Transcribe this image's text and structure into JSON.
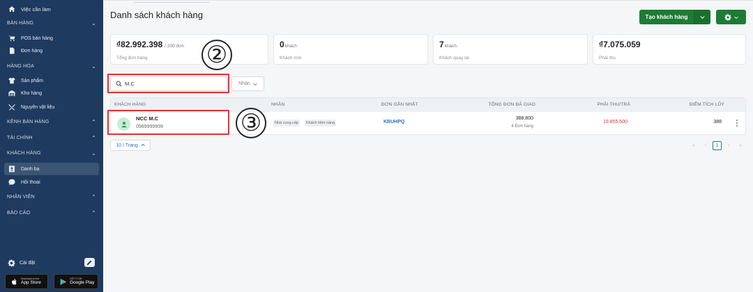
{
  "sidebar": {
    "todo_label": "Việc cần làm",
    "sections": {
      "ban_hang": "BÁN HÀNG",
      "hang_hoa": "HÀNG HÓA",
      "kenh_ban_hang": "KÊNH BÁN HÀNG",
      "tai_chinh": "TÀI CHÍNH",
      "khach_hang": "KHÁCH HÀNG",
      "nhan_vien": "NHÂN VIÊN",
      "bao_cao": "BÁO CÁO"
    },
    "items": {
      "pos": "POS bán hàng",
      "don_hang": "Đơn hàng",
      "san_pham": "Sản phẩm",
      "kho_hang": "Kho hàng",
      "nguyen_vat_lieu": "Nguyên vật liệu",
      "danh_ba": "Danh bạ",
      "hoi_thoai": "Hội thoại"
    },
    "settings_label": "Cài đặt",
    "app_store": {
      "small": "Download on the",
      "big": "App Store"
    },
    "google_play": {
      "small": "GET IT ON",
      "big": "Google Play"
    }
  },
  "header": {
    "title": "Danh sách khách hàng",
    "create_button": "Tạo khách hàng"
  },
  "stats": [
    {
      "value": "₫82.992.398",
      "suffix": "/ 200 đơn",
      "caption": "Tổng đơn hàng"
    },
    {
      "value": "0",
      "suffix": "khách",
      "caption": "Khách mới"
    },
    {
      "value": "7",
      "suffix": "khách",
      "caption": "Khách quay lại"
    },
    {
      "value": "₫7.075.059",
      "suffix": "",
      "caption": "Phải thu"
    }
  ],
  "search": {
    "value": "M.C",
    "placeholder": ""
  },
  "tag_filter_label": "Nhãn",
  "annotations": {
    "circle_2": "②",
    "circle_3": "③"
  },
  "table": {
    "headers": {
      "customer": "KHÁCH HÀNG",
      "tags": "NHÃN",
      "last_order": "ĐƠN GẦN NHẤT",
      "total_delivered": "TỔNG ĐƠN ĐÃ GIAO",
      "receivable": "PHẢI THU/TRẢ",
      "points": "ĐIỂM TÍCH LŨY"
    },
    "rows": [
      {
        "name": "NCC M.C",
        "phone": "0989999999",
        "tags": [
          "Nhà cung cấp",
          "Khách tiềm năng"
        ],
        "last_order": "KBUHPQ",
        "total_amount": "388.800",
        "total_orders": "4 Đơn hàng",
        "receivable": "19.855.600",
        "points": "388"
      }
    ]
  },
  "pagination": {
    "page_size": "10 / Trang",
    "current_page": "1",
    "first": "«",
    "prev": "‹",
    "next": "›",
    "last": "»"
  },
  "colors": {
    "sidebar_bg": "#1e3a5f",
    "primary_green": "#1c7c34",
    "link_blue": "#2f6fb6",
    "negative_red": "#d9363e",
    "annotation_red": "#e62e2e"
  }
}
